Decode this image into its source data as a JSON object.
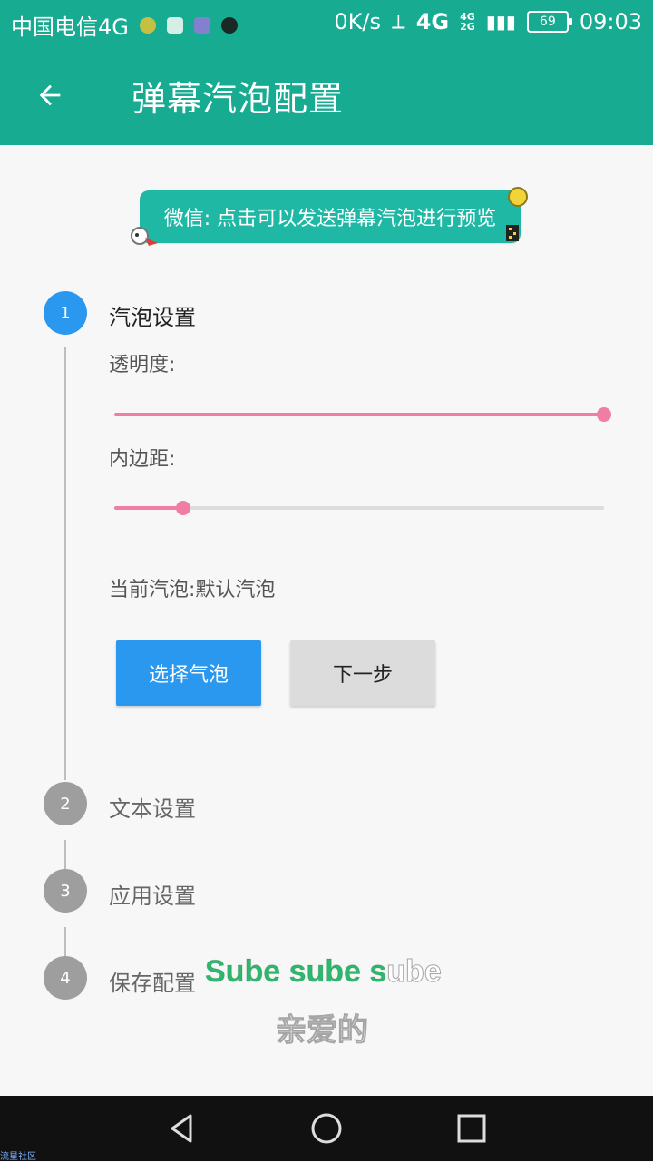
{
  "status_bar": {
    "carrier": "中国电信4G",
    "net_speed": "0K/s",
    "net_4g": "4G",
    "net_4g_small": "4G",
    "net_2g_small": "2G",
    "battery": "69",
    "time": "09:03"
  },
  "app_bar": {
    "back_icon": "arrow-left-icon",
    "title": "弹幕汽泡配置"
  },
  "preview_bubble": {
    "text": "微信: 点击可以发送弹幕汽泡进行预览"
  },
  "steps": [
    {
      "number": "1",
      "label": "汽泡设置",
      "state": "active"
    },
    {
      "number": "2",
      "label": "文本设置",
      "state": "inactive"
    },
    {
      "number": "3",
      "label": "应用设置",
      "state": "inactive"
    },
    {
      "number": "4",
      "label": "保存配置",
      "state": "inactive"
    }
  ],
  "bubble_settings": {
    "opacity_label": "透明度:",
    "opacity_level": 1.0,
    "padding_label": "内边距:",
    "padding_level": 0.14,
    "current_bubble": "当前汽泡:默认汽泡",
    "choose_button": "选择气泡",
    "next_button": "下一步"
  },
  "overlay_text": {
    "line1_green": "Sube sube s",
    "line1_white": "ube",
    "line2": "亲爱的"
  },
  "nav_bar": {
    "back": "triangle-back-icon",
    "home": "circle-home-icon",
    "recents": "square-recents-icon"
  },
  "watermark": "流星社区",
  "colors": {
    "accent": "#17ab91",
    "primary_button": "#2b98f0",
    "slider": "#f07ea3"
  }
}
